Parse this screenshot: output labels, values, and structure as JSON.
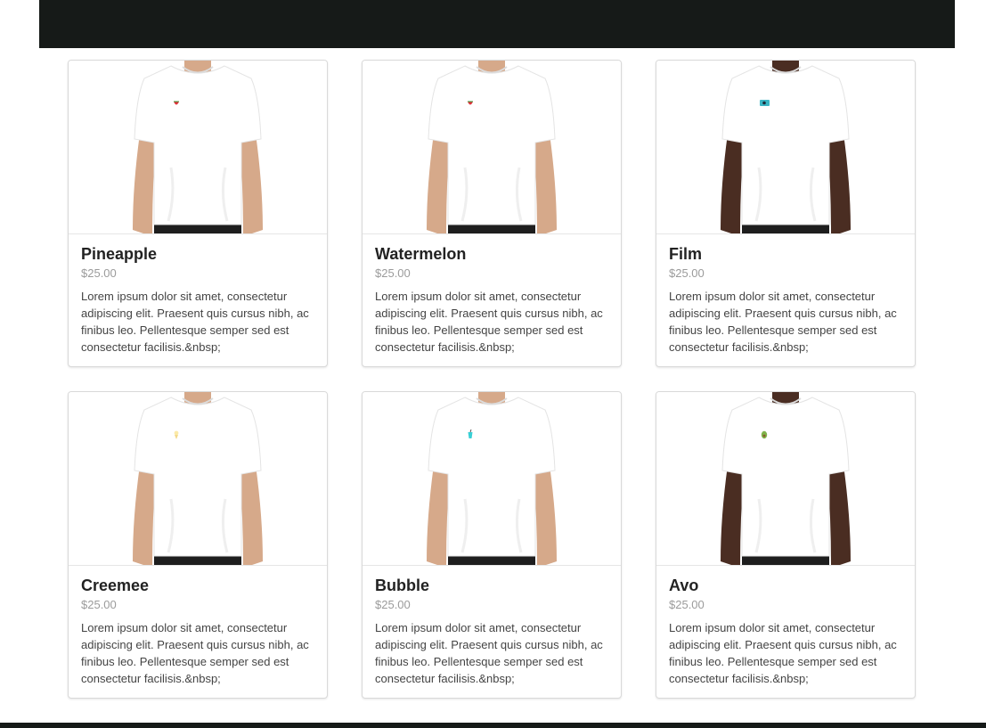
{
  "products": [
    {
      "title": "Pineapple",
      "price": "$25.00",
      "description": "Lorem ipsum dolor sit amet, consectetur adipiscing elit. Praesent quis cursus nibh, ac finibus leo. Pellentesque semper sed est consectetur facilisis.&nbsp;",
      "skin": "#d6a98a",
      "skin_shadow": "#b78667",
      "badge": "watermelon-slice-icon",
      "badge_color": "#e0313b"
    },
    {
      "title": "Watermelon",
      "price": "$25.00",
      "description": "Lorem ipsum dolor sit amet, consectetur adipiscing elit. Praesent quis cursus nibh, ac finibus leo. Pellentesque semper sed est consectetur facilisis.&nbsp;",
      "skin": "#d6a98a",
      "skin_shadow": "#b78667",
      "badge": "watermelon-slice-icon",
      "badge_color": "#e0313b"
    },
    {
      "title": "Film",
      "price": "$25.00",
      "description": "Lorem ipsum dolor sit amet, consectetur adipiscing elit. Praesent quis cursus nibh, ac finibus leo. Pellentesque semper sed est consectetur facilisis.&nbsp;",
      "skin": "#4a2d22",
      "skin_shadow": "#33201a",
      "badge": "film-camera-icon",
      "badge_color": "#3bb5c4"
    },
    {
      "title": "Creemee",
      "price": "$25.00",
      "description": "Lorem ipsum dolor sit amet, consectetur adipiscing elit. Praesent quis cursus nibh, ac finibus leo. Pellentesque semper sed est consectetur facilisis.&nbsp;",
      "skin": "#d6a98a",
      "skin_shadow": "#b78667",
      "badge": "ice-cream-cone-icon",
      "badge_color": "#f3d98a"
    },
    {
      "title": "Bubble",
      "price": "$25.00",
      "description": "Lorem ipsum dolor sit amet, consectetur adipiscing elit. Praesent quis cursus nibh, ac finibus leo. Pellentesque semper sed est consectetur facilisis.&nbsp;",
      "skin": "#d6a98a",
      "skin_shadow": "#b78667",
      "badge": "bubble-tea-icon",
      "badge_color": "#39d0d6"
    },
    {
      "title": "Avo",
      "price": "$25.00",
      "description": "Lorem ipsum dolor sit amet, consectetur adipiscing elit. Praesent quis cursus nibh, ac finibus leo. Pellentesque semper sed est consectetur facilisis.&nbsp;",
      "skin": "#4a2d22",
      "skin_shadow": "#33201a",
      "badge": "avocado-icon",
      "badge_color": "#7fb34a"
    }
  ],
  "colors": {
    "bar": "#161a18",
    "card_border": "#d9d9d9",
    "price": "#9b9b9b",
    "shirt": "#ffffff",
    "pants": "#1e1e1e"
  }
}
